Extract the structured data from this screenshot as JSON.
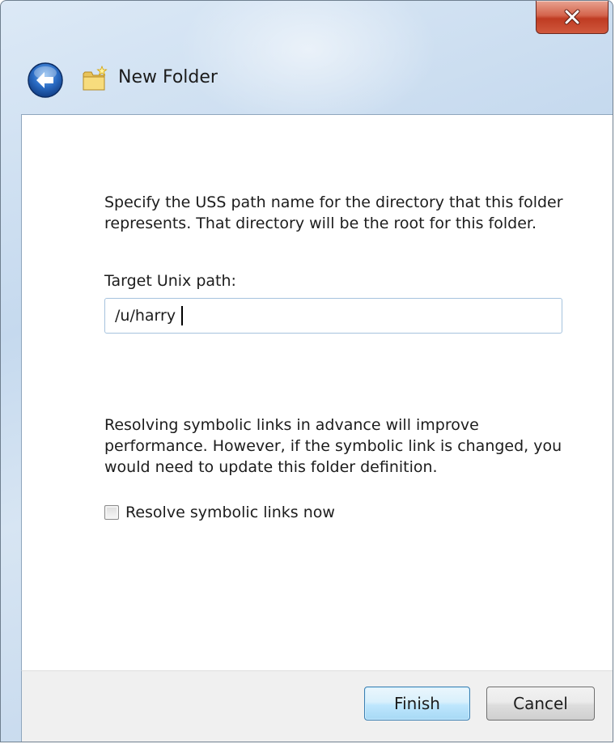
{
  "window": {
    "title": "New Folder"
  },
  "main": {
    "description": "Specify the USS path name for the directory that this folder represents.  That directory will be the root for this folder.",
    "path_label": "Target Unix path:",
    "path_value": "/u/harry",
    "symlink_note": "Resolving symbolic links in advance will improve performance.  However, if the symbolic link is changed, you would need to update this folder definition.",
    "resolve_checkbox": {
      "label": "Resolve symbolic links now",
      "checked": false
    }
  },
  "footer": {
    "finish_label": "Finish",
    "cancel_label": "Cancel"
  },
  "icons": {
    "close": "close-icon",
    "back": "back-arrow-icon",
    "folder": "new-folder-icon"
  },
  "colors": {
    "close_button": "#c8462c",
    "back_button": "#2a6cc4",
    "default_button_border": "#3c7fb1"
  }
}
